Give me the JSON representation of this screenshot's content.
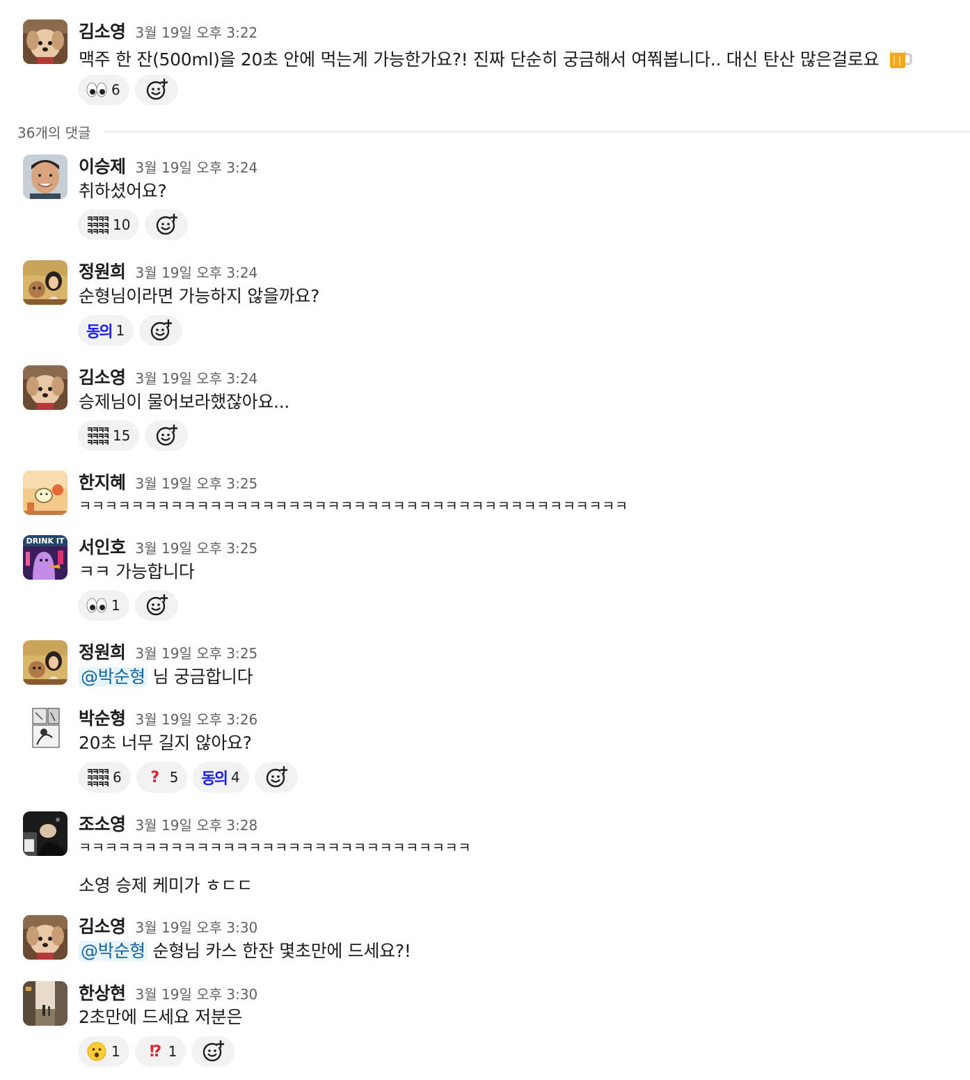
{
  "thread_divider": {
    "label": "36개의 댓글"
  },
  "messages": [
    {
      "author": "김소영",
      "time": "3월 19일 오후 3:22",
      "text": "맥주 한 잔(500ml)을 20초 안에 먹는게 가능한가요?! 진짜 단순히 궁금해서 여쭤봅니다.. 대신 탄산 많은걸로요",
      "trailing_emoji": "beer-mug-icon",
      "avatar": "dog-avatar",
      "reactions": [
        {
          "emoji": "eyes-icon",
          "count": "6"
        }
      ]
    },
    {
      "author": "이승제",
      "time": "3월 19일 오후 3:24",
      "text": "취하셨어요?",
      "avatar": "man-avatar",
      "reactions": [
        {
          "emoji": "kkkk-icon",
          "count": "10"
        }
      ]
    },
    {
      "author": "정원희",
      "time": "3월 19일 오후 3:24",
      "text": "순형님이라면 가능하지 않을까요?",
      "avatar": "woman-dog-avatar",
      "reactions": [
        {
          "emoji": "agree-icon",
          "label": "동의",
          "count": "1"
        }
      ]
    },
    {
      "author": "김소영",
      "time": "3월 19일 오후 3:24",
      "text": "승제님이 물어보라했잖아요...",
      "avatar": "dog-avatar",
      "reactions": [
        {
          "emoji": "kkkk-icon",
          "count": "15"
        }
      ]
    },
    {
      "author": "한지혜",
      "time": "3월 19일 오후 3:25",
      "text": "ㅋㅋㅋㅋㅋㅋㅋㅋㅋㅋㅋㅋㅋㅋㅋㅋㅋㅋㅋㅋㅋㅋㅋㅋㅋㅋㅋㅋㅋㅋㅋㅋㅋㅋㅋㅋㅋㅋㅋㅋㅋㅋ",
      "avatar": "cartoon-avatar",
      "reactions": []
    },
    {
      "author": "서인호",
      "time": "3월 19일 오후 3:25",
      "text": "ㅋㅋ 가능합니다",
      "avatar": "drink-it-avatar",
      "avatar_text": "DRINK IT",
      "reactions": [
        {
          "emoji": "eyes-icon",
          "count": "1"
        }
      ]
    },
    {
      "author": "정원희",
      "time": "3월 19일 오후 3:25",
      "mention": "@박순형",
      "text": " 님 궁금합니다",
      "avatar": "woman-dog-avatar",
      "reactions": []
    },
    {
      "author": "박순형",
      "time": "3월 19일 오후 3:26",
      "text": "20초 너무 길지 않아요?",
      "avatar": "manga-avatar",
      "reactions": [
        {
          "emoji": "kkkk-icon",
          "count": "6"
        },
        {
          "emoji": "question-mark-icon",
          "count": "5"
        },
        {
          "emoji": "agree-icon",
          "label": "동의",
          "count": "4"
        }
      ]
    },
    {
      "author": "조소영",
      "time": "3월 19일 오후 3:28",
      "text": "ㅋㅋㅋㅋㅋㅋㅋㅋㅋㅋㅋㅋㅋㅋㅋㅋㅋㅋㅋㅋㅋㅋㅋㅋㅋㅋㅋㅋㅋㅋ",
      "text2": "소영 승제 케미가 ㅎㄷㄷ",
      "avatar": "dark-photo-avatar",
      "reactions": []
    },
    {
      "author": "김소영",
      "time": "3월 19일 오후 3:30",
      "mention": "@박순형",
      "text": " 순형님 카스 한잔 몇초만에 드세요?!",
      "avatar": "dog-avatar",
      "reactions": []
    },
    {
      "author": "한상현",
      "time": "3월 19일 오후 3:30",
      "text": "2초만에 드세요 저분은",
      "avatar": "street-avatar",
      "reactions": [
        {
          "emoji": "hushed-face-icon",
          "count": "1"
        },
        {
          "emoji": "exclamation-question-icon",
          "count": "1"
        }
      ]
    }
  ],
  "add_reaction": {
    "icon": "add-reaction-icon"
  },
  "colors": {
    "text": "#1d1c1d",
    "muted": "#616061",
    "mention": "#1264a3",
    "mention_bg": "#e8f5fa",
    "pill_bg": "#f2f2f2"
  }
}
